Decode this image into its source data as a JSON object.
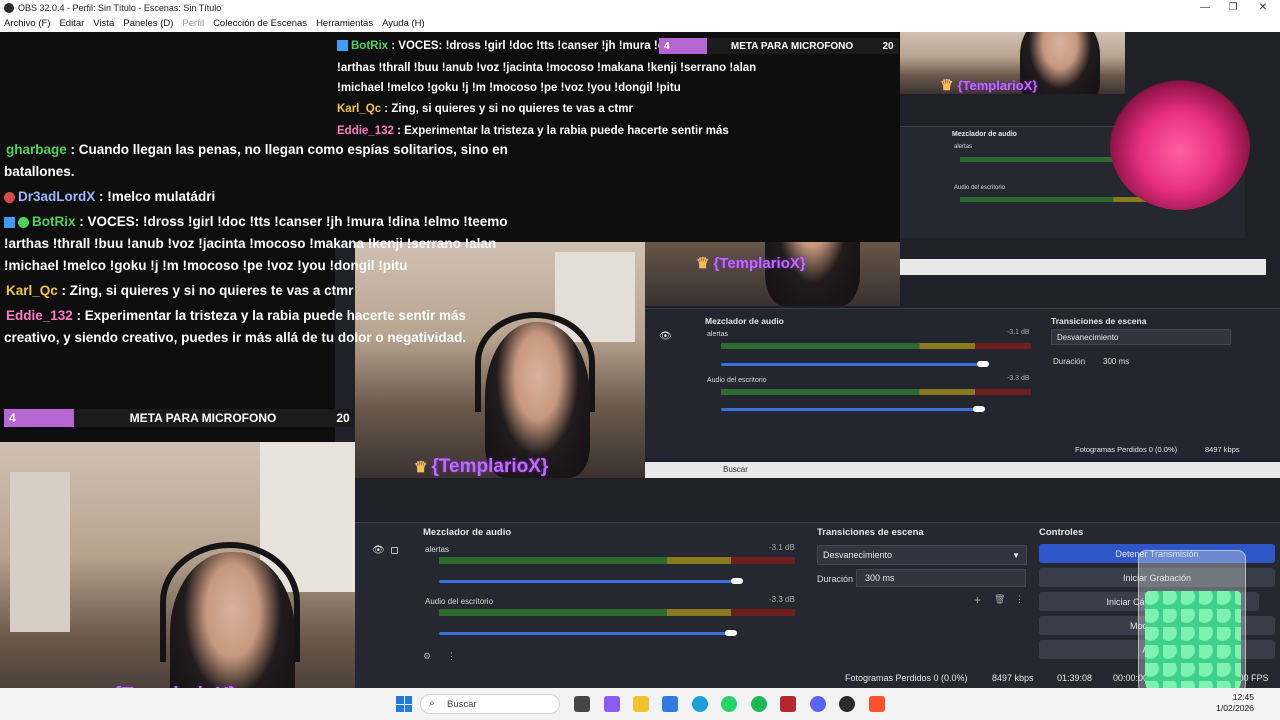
{
  "window": {
    "title": "OBS 32.0.4 - Perfil: Sin Título - Escenas: Sin Título",
    "controls": [
      "—",
      "❐",
      "✕"
    ]
  },
  "menu": {
    "items": [
      "Archivo (F)",
      "Editar",
      "Vista",
      "Paneles (D)",
      "Perfil",
      "Colección de Escenas",
      "Herramientas",
      "Ayuda (H)"
    ]
  },
  "chat": {
    "messages": [
      {
        "user": "gharbage",
        "user_color": "#4fd15a",
        "text": " : Cuando llegan las penas, no llegan como espías solitarios, sino en",
        "cont": "batallones."
      },
      {
        "user": "Dr3adLordX",
        "user_color": "#9ab6ff",
        "text": " : !melco mulatádri"
      },
      {
        "user": "BotRix",
        "user_color": "#4fd15a",
        "text": " : VOCES: !dross !girl !doc !tts !canser !jh !mura !dina !elmo !teemo",
        "cont": "!arthas !thrall !buu !anub !voz !jacinta !mocoso !makana !kenji !serrano !alan",
        "cont2": "!michael !melco !goku !j !m !mocoso !pe !voz !you !dongil !pitu"
      },
      {
        "user": "Karl_Qc",
        "user_color": "#f2c443",
        "text": " : Zing, si quieres y si no quieres te vas a ctmr"
      },
      {
        "user": "Eddie_132",
        "user_color": "#ff7bc4",
        "text": " : Experimentar la tristeza y la rabia puede hacerte sentir más",
        "cont": "creativo, y siendo creativo, puedes ir más allá de tu dolor o negatividad."
      }
    ],
    "goal": {
      "current": "4",
      "label": "META PARA MICROFONO",
      "target": "20",
      "progress": 0.2
    }
  },
  "overlay": {
    "streamer": "{TemplarioX}"
  },
  "mixer": {
    "title": "Mezclador de audio",
    "channels": [
      {
        "name": "alertas",
        "db": "-3.1 dB",
        "level": 0.92
      },
      {
        "name": "Audio del escritorio",
        "db": "-3.3 dB",
        "level": 0.9
      }
    ],
    "scale": [
      "-60",
      "-55",
      "-50",
      "-45",
      "-40",
      "-35",
      "-30",
      "-25",
      "-20",
      "-15",
      "-10",
      "-5",
      "0"
    ]
  },
  "transitions": {
    "title": "Transiciones de escena",
    "selected": "Desvanecimiento",
    "duration_label": "Duración",
    "duration_value": "300 ms"
  },
  "controls": {
    "title": "Controles",
    "buttons": [
      "Detener Transmisión",
      "Iniciar Grabación",
      "Iniciar Cámara virtual",
      "Modo estudio",
      "Ajustes"
    ]
  },
  "status": {
    "dropped": "Fotogramas Perdidos 0 (0.0%)",
    "bitrate": "8497 kbps",
    "stream_time": "01:39:08",
    "rec_time": "00:00:00",
    "fps": "60.00 FPS"
  },
  "taskbar": {
    "search_placeholder": "Buscar",
    "time": "12:45",
    "date": "1/02/2026"
  }
}
